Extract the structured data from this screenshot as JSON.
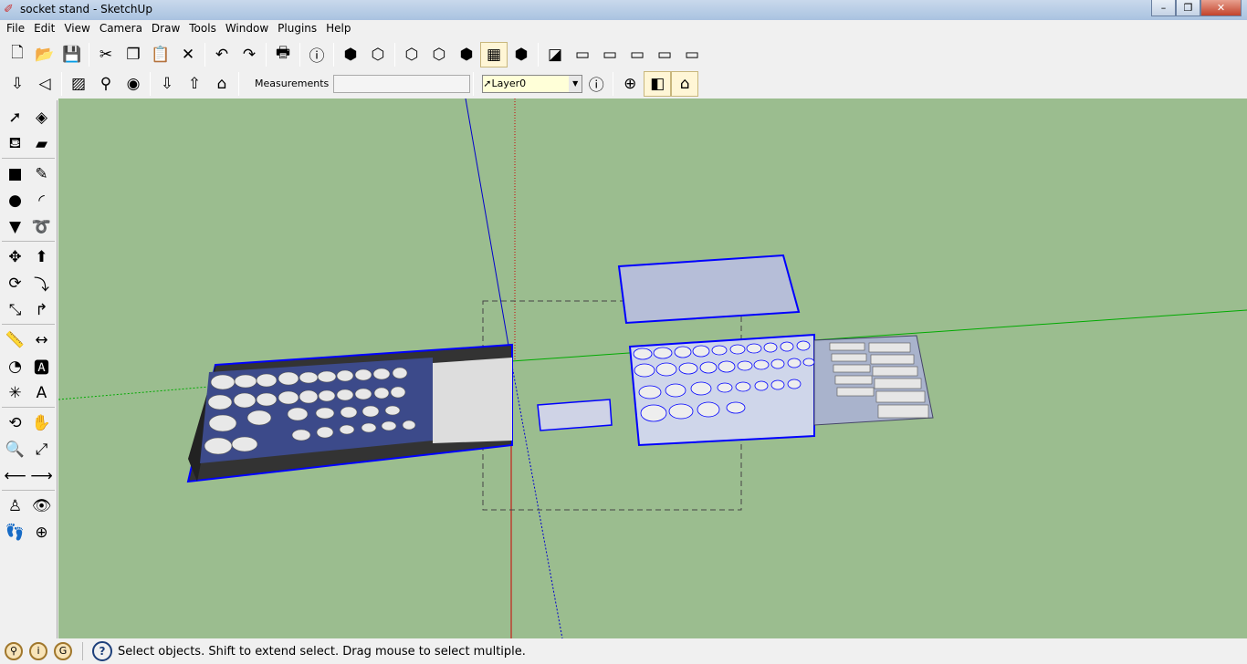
{
  "window": {
    "title": "socket stand - SketchUp",
    "controls": [
      "minimize",
      "maximize",
      "close"
    ]
  },
  "menu": [
    "File",
    "Edit",
    "View",
    "Camera",
    "Draw",
    "Tools",
    "Window",
    "Plugins",
    "Help"
  ],
  "toolbar1": [
    {
      "name": "new-icon",
      "g": "🗋"
    },
    {
      "name": "open-icon",
      "g": "📂"
    },
    {
      "name": "save-icon",
      "g": "💾"
    },
    "|",
    {
      "name": "cut-icon",
      "g": "✂"
    },
    {
      "name": "copy-icon",
      "g": "❐"
    },
    {
      "name": "paste-icon",
      "g": "📋"
    },
    {
      "name": "erase-icon",
      "g": "✕"
    },
    "|",
    {
      "name": "undo-icon",
      "g": "↶"
    },
    {
      "name": "redo-icon",
      "g": "↷"
    },
    "|",
    {
      "name": "print-icon",
      "g": "🖶"
    },
    "|",
    {
      "name": "model-info-icon",
      "g": "ⓘ"
    },
    "|",
    {
      "name": "xray-icon",
      "g": "⬢"
    },
    {
      "name": "back-edges-icon",
      "g": "⬡"
    },
    "|",
    {
      "name": "wireframe-icon",
      "g": "⬡"
    },
    {
      "name": "hidden-line-icon",
      "g": "⬡"
    },
    {
      "name": "shaded-icon",
      "g": "⬢"
    },
    {
      "name": "shaded-textures-icon",
      "g": "▦",
      "on": true
    },
    {
      "name": "monochrome-icon",
      "g": "⬢"
    },
    "|",
    {
      "name": "iso-view-icon",
      "g": "◪"
    },
    {
      "name": "top-view-icon",
      "g": "▭"
    },
    {
      "name": "front-view-icon",
      "g": "▭"
    },
    {
      "name": "right-view-icon",
      "g": "▭"
    },
    {
      "name": "back-view-icon",
      "g": "▭"
    },
    {
      "name": "left-view-icon",
      "g": "▭"
    }
  ],
  "toolbar2": [
    {
      "name": "get-models-icon",
      "g": "⇩"
    },
    {
      "name": "share-model-icon",
      "g": "◁"
    },
    "|",
    {
      "name": "get-photo-texture-icon",
      "g": "▨"
    },
    {
      "name": "add-location-icon",
      "g": "⚲"
    },
    {
      "name": "google-earth-icon",
      "g": "◉"
    },
    "|",
    {
      "name": "import-icon",
      "g": "⇩"
    },
    {
      "name": "export-icon",
      "g": "⇧"
    },
    {
      "name": "share-component-icon",
      "g": "⌂"
    }
  ],
  "measurements": {
    "label": "Measurements",
    "value": ""
  },
  "layer": {
    "selected": "Layer0"
  },
  "toolbar2_right": [
    {
      "name": "layer-manager-icon",
      "g": "ⓘ"
    },
    "|",
    {
      "name": "section-plane-icon",
      "g": "⊕"
    },
    {
      "name": "display-section-planes-icon",
      "g": "◧",
      "on": true
    },
    {
      "name": "display-section-cuts-icon",
      "g": "⌂",
      "on": true
    }
  ],
  "left_tools": [
    {
      "name": "select-icon",
      "g": "➚"
    },
    {
      "name": "make-component-icon",
      "g": "◈"
    },
    {
      "name": "paint-bucket-icon",
      "g": "⛾"
    },
    {
      "name": "eraser-icon",
      "g": "▰"
    },
    "-",
    {
      "name": "rectangle-icon",
      "g": "■"
    },
    {
      "name": "line-icon",
      "g": "✎"
    },
    {
      "name": "circle-icon",
      "g": "●"
    },
    {
      "name": "arc-icon",
      "g": "◜"
    },
    {
      "name": "polygon-icon",
      "g": "▼"
    },
    {
      "name": "freehand-icon",
      "g": "➰"
    },
    "-",
    {
      "name": "move-icon",
      "g": "✥"
    },
    {
      "name": "push-pull-icon",
      "g": "⬆"
    },
    {
      "name": "rotate-icon",
      "g": "⟳"
    },
    {
      "name": "follow-me-icon",
      "g": "⤵"
    },
    {
      "name": "scale-icon",
      "g": "⤡"
    },
    {
      "name": "offset-icon",
      "g": "↱"
    },
    "-",
    {
      "name": "tape-measure-icon",
      "g": "📏"
    },
    {
      "name": "dimension-icon",
      "g": "↔"
    },
    {
      "name": "protractor-icon",
      "g": "◔"
    },
    {
      "name": "text-icon",
      "g": "🅰"
    },
    {
      "name": "axes-icon",
      "g": "✳"
    },
    {
      "name": "3d-text-icon",
      "g": "A"
    },
    "-",
    {
      "name": "orbit-icon",
      "g": "⟲"
    },
    {
      "name": "pan-icon",
      "g": "✋"
    },
    {
      "name": "zoom-icon",
      "g": "🔍"
    },
    {
      "name": "zoom-extents-icon",
      "g": "⤢"
    },
    {
      "name": "previous-view-icon",
      "g": "⟵"
    },
    {
      "name": "next-view-icon",
      "g": "⟶"
    },
    "-",
    {
      "name": "position-camera-icon",
      "g": "♙"
    },
    {
      "name": "look-around-icon",
      "g": "👁"
    },
    {
      "name": "walk-icon",
      "g": "👣"
    },
    {
      "name": "section-plane-tool-icon",
      "g": "⊕"
    }
  ],
  "status": {
    "icons": [
      {
        "name": "geo-location-icon",
        "g": "⚲"
      },
      {
        "name": "credits-icon",
        "g": "i"
      },
      {
        "name": "login-icon",
        "g": "G"
      }
    ],
    "help_icon": "?",
    "text": "Select objects. Shift to extend select. Drag mouse to select multiple."
  },
  "colors": {
    "viewport": "#9bbd8f",
    "selection": "#0000ff",
    "axis_red": "#cc0000",
    "axis_green": "#00aa00",
    "axis_blue": "#0000cc"
  }
}
